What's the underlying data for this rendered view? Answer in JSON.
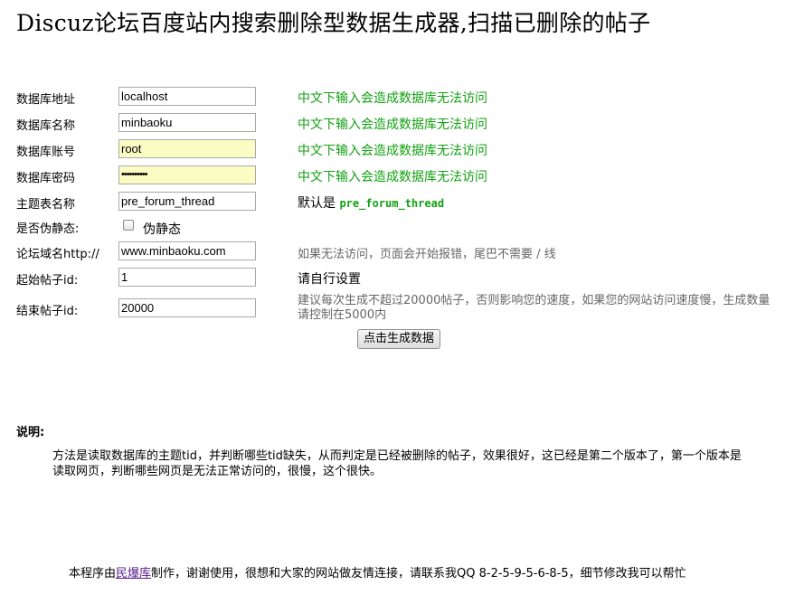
{
  "title": "Discuz论坛百度站内搜索删除型数据生成器,扫描已删除的帖子",
  "form": {
    "db_host_label": "数据库地址",
    "db_host_value": "localhost",
    "db_name_label": "数据库名称",
    "db_name_value": "minbaoku",
    "db_user_label": "数据库账号",
    "db_user_value": "root",
    "db_pass_label": "数据库密码",
    "db_pass_value": "••••••••••",
    "table_label": "主题表名称",
    "table_value": "pre_forum_thread",
    "static_label": "是否伪静态:",
    "static_checkbox_label": "伪静态",
    "domain_label": "论坛域名http://",
    "domain_value": "www.minbaoku.com",
    "start_label": "起始帖子id:",
    "start_value": "1",
    "end_label": "结束帖子id:",
    "end_value": "20000",
    "submit_label": "点击生成数据"
  },
  "hints": {
    "db_host": "中文下输入会造成数据库无法访问",
    "db_name": "中文下输入会造成数据库无法访问",
    "db_user": "中文下输入会造成数据库无法访问",
    "db_pass": "中文下输入会造成数据库无法访问",
    "table_prefix": "默认是",
    "table_default": "pre_forum_thread",
    "domain": "如果无法访问，页面会开始报错，尾巴不需要 / 线",
    "start": "请自行设置",
    "end": "建议每次生成不超过20000帖子，否则影响您的速度，如果您的网站访问速度慢，生成数量请控制在5000内"
  },
  "explanation": {
    "heading": "说明:",
    "text": "方法是读取数据库的主题tid，并判断哪些tid缺失，从而判定是已经被删除的帖子，效果很好，这已经是第二个版本了，第一个版本是读取网页，判断哪些网页是无法正常访问的，很慢，这个很快。"
  },
  "footer": {
    "prefix": "本程序由",
    "link": "民爆库",
    "suffix": "制作，谢谢使用，很想和大家的网站做友情连接，请联系我QQ 8-2-5-9-5-6-8-5，细节修改我可以帮忙"
  }
}
